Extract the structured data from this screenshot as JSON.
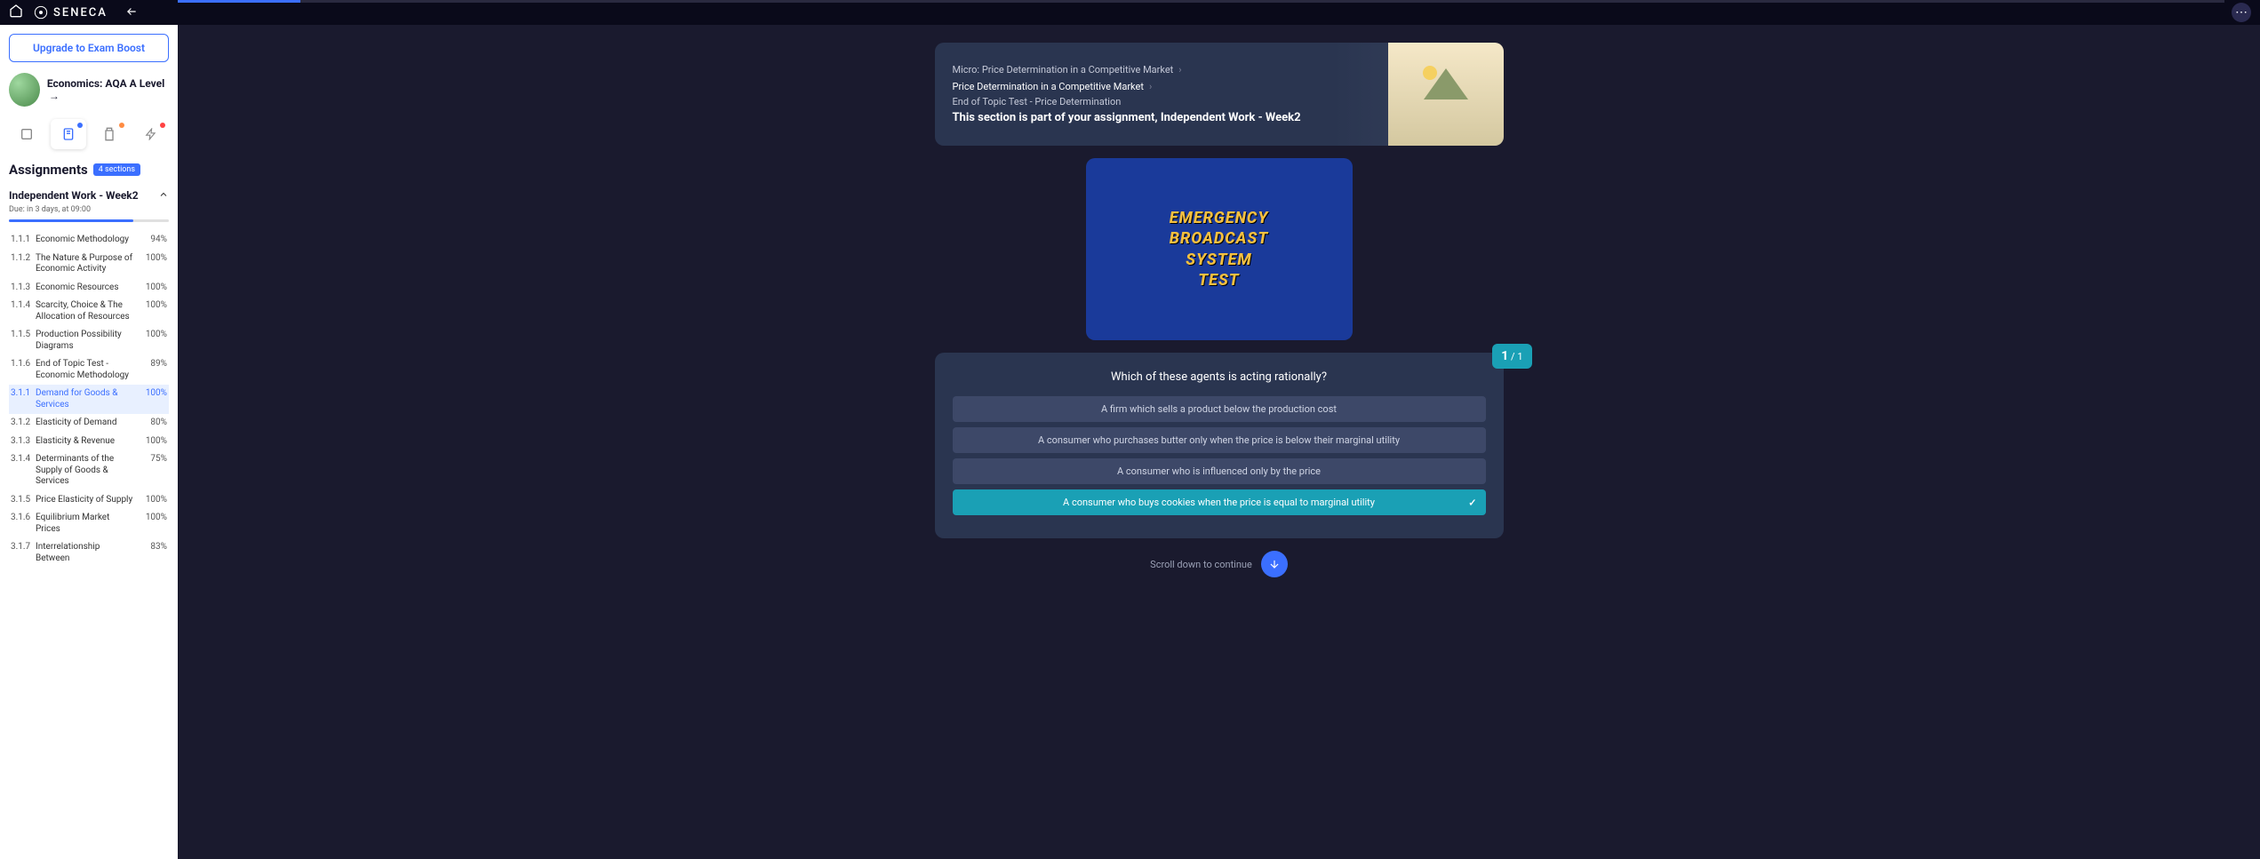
{
  "brand": "SENECA",
  "sidebar": {
    "upgrade_label": "Upgrade to Exam Boost",
    "course_name": "Economics: AQA A Level",
    "course_arrow": "→",
    "assignments_title": "Assignments",
    "assignments_badge": "4 sections",
    "assignment": {
      "title": "Independent Work - Week2",
      "due": "Due: in 3 days, at 09:00"
    },
    "sections": [
      {
        "num": "1.1.1",
        "name": "Economic Methodology",
        "pct": "94%"
      },
      {
        "num": "1.1.2",
        "name": "The Nature & Purpose of Economic Activity",
        "pct": "100%"
      },
      {
        "num": "1.1.3",
        "name": "Economic Resources",
        "pct": "100%"
      },
      {
        "num": "1.1.4",
        "name": "Scarcity, Choice & The Allocation of Resources",
        "pct": "100%"
      },
      {
        "num": "1.1.5",
        "name": "Production Possibility Diagrams",
        "pct": "100%"
      },
      {
        "num": "1.1.6",
        "name": "End of Topic Test - Economic Methodology",
        "pct": "89%"
      },
      {
        "num": "3.1.1",
        "name": "Demand for Goods & Services",
        "pct": "100%"
      },
      {
        "num": "3.1.2",
        "name": "Elasticity of Demand",
        "pct": "80%"
      },
      {
        "num": "3.1.3",
        "name": "Elasticity & Revenue",
        "pct": "100%"
      },
      {
        "num": "3.1.4",
        "name": "Determinants of the Supply of Goods & Services",
        "pct": "75%"
      },
      {
        "num": "3.1.5",
        "name": "Price Elasticity of Supply",
        "pct": "100%"
      },
      {
        "num": "3.1.6",
        "name": "Equilibrium Market Prices",
        "pct": "100%"
      },
      {
        "num": "3.1.7",
        "name": "Interrelationship Between",
        "pct": "83%"
      }
    ]
  },
  "header": {
    "crumb1": "Micro: Price Determination in a Competitive Market",
    "crumb2": "Price Determination in a Competitive Market",
    "topic": "End of Topic Test - Price Determination",
    "assignment_line": "This section is part of your assignment, Independent Work - Week2"
  },
  "media": {
    "line1": "EMERGENCY",
    "line2": "BROADCAST",
    "line3": "SYSTEM",
    "line4": "TEST"
  },
  "question": {
    "counter_current": "1",
    "counter_sep": "/",
    "counter_total": "1",
    "text": "Which of these agents is acting rationally?",
    "options": [
      "A firm which sells a product below the production cost",
      "A consumer who purchases butter only when the price is below their marginal utility",
      "A consumer who is influenced only by the price",
      "A consumer who buys cookies when the price is equal to marginal utility"
    ]
  },
  "scroll_label": "Scroll down to continue"
}
